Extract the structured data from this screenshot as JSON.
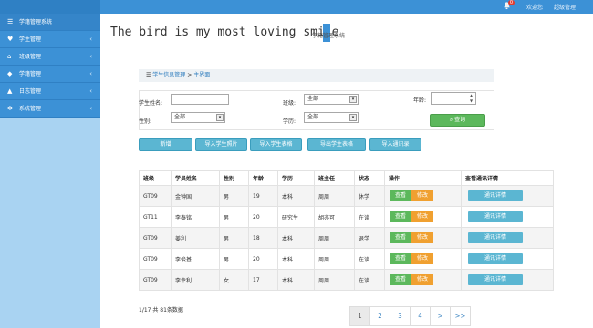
{
  "sidebar": {
    "title": "学籍管理系统",
    "items": [
      {
        "label": "学生管理",
        "icon": "heart-icon"
      },
      {
        "label": "班级管理",
        "icon": "home-icon"
      },
      {
        "label": "学籍管理",
        "icon": "tag-icon"
      },
      {
        "label": "日志管理",
        "icon": "thumbs-up-icon"
      },
      {
        "label": "系统管理",
        "icon": "gears-icon"
      }
    ]
  },
  "topbar": {
    "user1": "欢迎您",
    "user2": "超级管理",
    "badge": "0"
  },
  "header": {
    "headline": "The bird is my most loving smile",
    "logo_text": "学籍管理系统"
  },
  "breadcrumb": {
    "root": "学生信息管理",
    "sep": ">",
    "current": "主界面"
  },
  "filter": {
    "name_label": "学生姓名:",
    "class_label": "班级:",
    "class_value": "全部",
    "age_label": "年龄:",
    "gender_label": "性别:",
    "gender_value": "全部",
    "edu_label": "学历:",
    "edu_value": "全部",
    "query_label": "查询"
  },
  "actions": [
    "新增",
    "导入学生照片",
    "导入学生表格",
    "导出学生表格",
    "导入通讯录"
  ],
  "table": {
    "headers": [
      "班级",
      "学员姓名",
      "性别",
      "年龄",
      "学历",
      "班主任",
      "状态",
      "操作",
      "查看通讯详情"
    ],
    "rows": [
      [
        "GT09",
        "金钟国",
        "男",
        "19",
        "本科",
        "周周",
        "休学"
      ],
      [
        "GT11",
        "李泰铭",
        "男",
        "20",
        "研究生",
        "胡亦可",
        "在读"
      ],
      [
        "GT09",
        "姜利",
        "男",
        "18",
        "本科",
        "周周",
        "退学"
      ],
      [
        "GT09",
        "李俊基",
        "男",
        "20",
        "本科",
        "周周",
        "在读"
      ],
      [
        "GT09",
        "李幸利",
        "女",
        "17",
        "本科",
        "周周",
        "在读"
      ]
    ],
    "view_label": "查看",
    "edit_label": "修改",
    "detail_label": "通讯详情"
  },
  "footer": {
    "count_text": "1/17 共 81条数据"
  },
  "pager": [
    "1",
    "2",
    "3",
    "4",
    ">",
    ">>"
  ],
  "colors": {
    "accent": "#3c91d6",
    "sidebar_bg": "#a9d3f2",
    "success": "#5cb85c",
    "warning": "#f0a030",
    "info": "#5bb6d2"
  }
}
